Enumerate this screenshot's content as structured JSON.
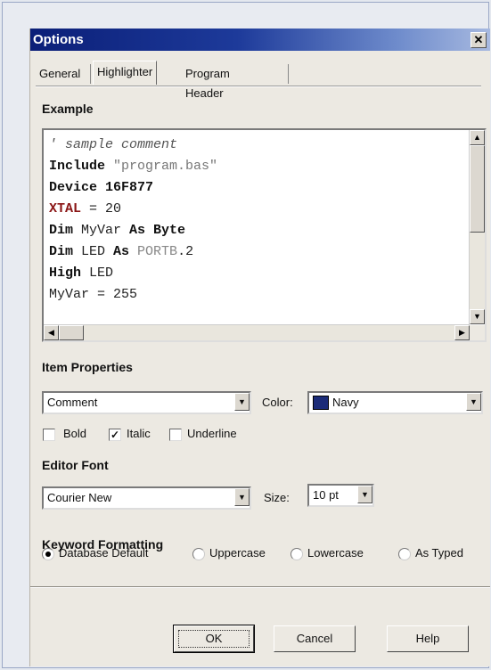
{
  "window": {
    "title": "Options",
    "close": "✕"
  },
  "tabs": [
    {
      "label": "General",
      "active": false
    },
    {
      "label": "Highlighter",
      "active": true
    },
    {
      "label": "Program Header",
      "active": false
    }
  ],
  "example": {
    "heading": "Example",
    "lines": [
      [
        {
          "t": "' sample comment",
          "s": "comment"
        }
      ],
      [
        {
          "t": "Include ",
          "s": "kw"
        },
        {
          "t": "\"program.bas\"",
          "s": "str"
        }
      ],
      [
        {
          "t": "Device 16F877",
          "s": "kw"
        }
      ],
      [
        {
          "t": "XTAL",
          "s": "red"
        },
        {
          "t": " = 20",
          "s": "plain"
        }
      ],
      [
        {
          "t": "Dim ",
          "s": "kw"
        },
        {
          "t": "MyVar ",
          "s": "plain"
        },
        {
          "t": "As Byte",
          "s": "kw"
        }
      ],
      [
        {
          "t": "Dim ",
          "s": "kw"
        },
        {
          "t": "LED ",
          "s": "plain"
        },
        {
          "t": "As ",
          "s": "kw"
        },
        {
          "t": "PORTB",
          "s": "grey"
        },
        {
          "t": ".2",
          "s": "plain"
        }
      ],
      [
        {
          "t": "High ",
          "s": "kw"
        },
        {
          "t": "LED",
          "s": "plain"
        }
      ],
      [
        {
          "t": "MyVar = 255",
          "s": "plain"
        }
      ]
    ]
  },
  "item_properties": {
    "heading": "Item Properties",
    "item_value": "Comment",
    "color_label": "Color:",
    "color_value": "Navy",
    "color_hex": "#1b2b78",
    "bold": {
      "label": "Bold",
      "checked": false
    },
    "italic": {
      "label": "Italic",
      "checked": true
    },
    "underline": {
      "label": "Underline",
      "checked": false
    }
  },
  "editor_font": {
    "heading": "Editor Font",
    "font_value": "Courier New",
    "size_label": "Size:",
    "size_value": "10 pt"
  },
  "keyword_formatting": {
    "heading": "Keyword Formatting",
    "options": [
      {
        "label": "Database Default",
        "selected": true
      },
      {
        "label": "Uppercase",
        "selected": false
      },
      {
        "label": "Lowercase",
        "selected": false
      },
      {
        "label": "As Typed",
        "selected": false
      }
    ]
  },
  "buttons": {
    "ok": "OK",
    "cancel": "Cancel",
    "help": "Help"
  }
}
